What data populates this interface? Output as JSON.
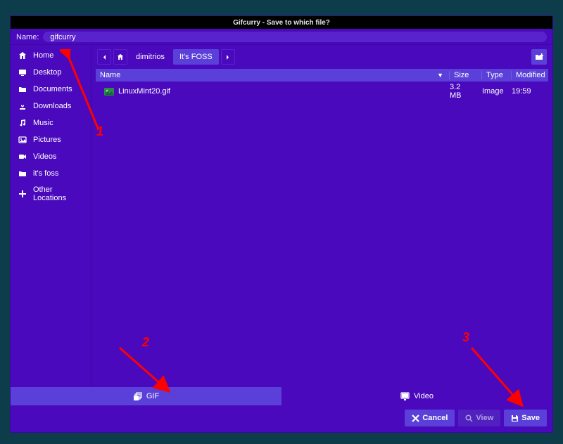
{
  "window_title": "Gifcurry - Save to which file?",
  "name": {
    "label": "Name:",
    "value": "gifcurry"
  },
  "sidebar": {
    "items": [
      {
        "icon": "home-icon",
        "label": "Home"
      },
      {
        "icon": "desktop-icon",
        "label": "Desktop"
      },
      {
        "icon": "folder-icon",
        "label": "Documents"
      },
      {
        "icon": "download-icon",
        "label": "Downloads"
      },
      {
        "icon": "music-icon",
        "label": "Music"
      },
      {
        "icon": "picture-icon",
        "label": "Pictures"
      },
      {
        "icon": "video-icon",
        "label": "Videos"
      },
      {
        "icon": "folder-icon",
        "label": "it's foss"
      },
      {
        "icon": "plus-icon",
        "label": "Other Locations"
      }
    ]
  },
  "breadcrumb": {
    "segments": [
      "dimitrios",
      "It's FOSS"
    ]
  },
  "table": {
    "headers": {
      "name": "Name",
      "size": "Size",
      "type": "Type",
      "modified": "Modified"
    },
    "rows": [
      {
        "name": "LinuxMint20.gif",
        "size": "3.2 MB",
        "type": "Image",
        "modified": "19:59"
      }
    ]
  },
  "formats": {
    "gif": "GIF",
    "video": "Video"
  },
  "buttons": {
    "cancel": "Cancel",
    "view": "View",
    "save": "Save"
  },
  "annotations": {
    "n1": "1",
    "n2": "2",
    "n3": "3"
  }
}
